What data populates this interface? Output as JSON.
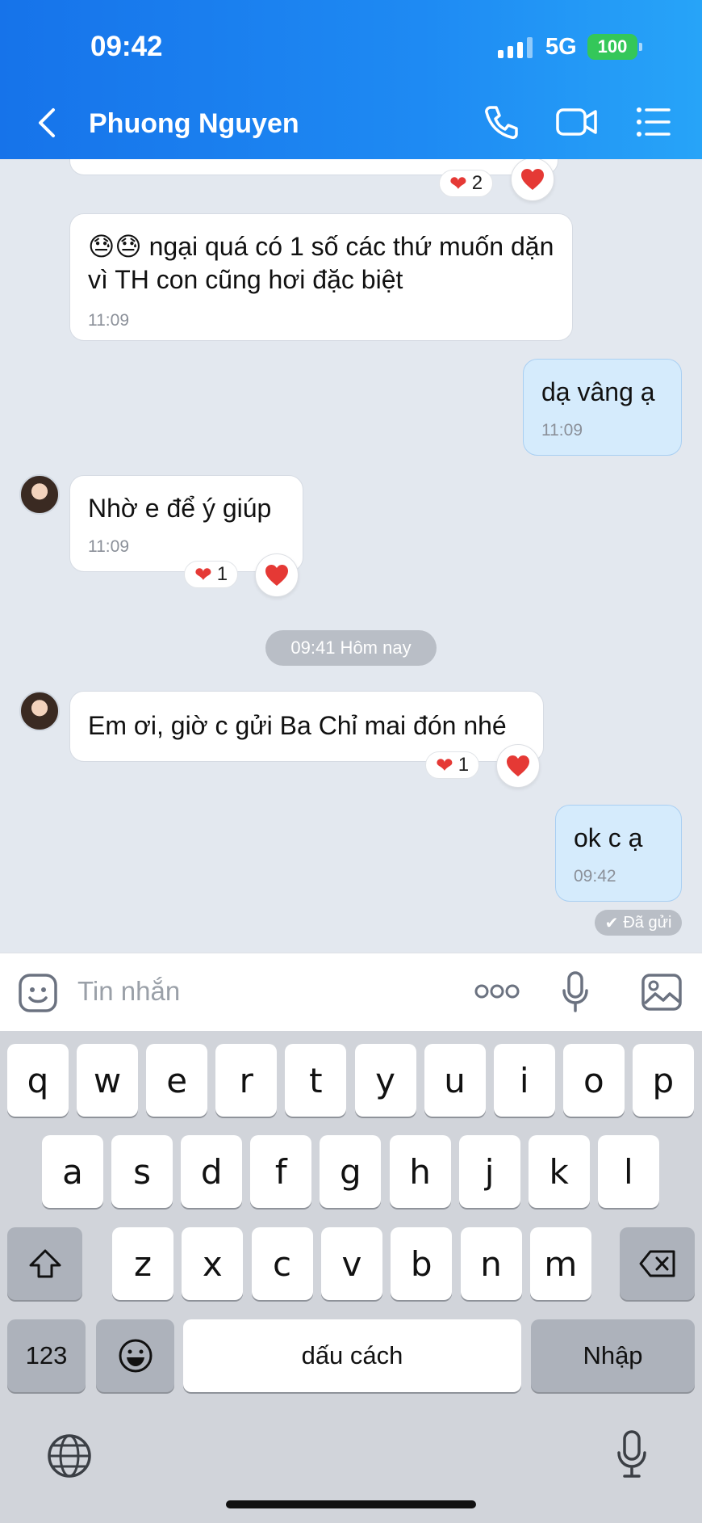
{
  "status": {
    "time": "09:42",
    "network": "5G",
    "battery": "100"
  },
  "header": {
    "contact_name": "Phuong Nguyen",
    "accent": "#1e8af3"
  },
  "messages": [
    {
      "sender": "other",
      "text": "ngại quá có 1 số các thứ muốn dặn vì TH con cũng hơi đặc biệt",
      "emojis": "😓😓",
      "time": "11:09"
    },
    {
      "sender": "me",
      "text": "dạ vâng ạ",
      "time": "11:09"
    },
    {
      "sender": "other",
      "text": "Nhờ e để ý giúp",
      "time": "11:09",
      "reaction_count": "1"
    },
    {
      "sender": "other",
      "text": "Em ơi, giờ c gửi Ba Chỉ mai đón nhé",
      "reaction_count": "1"
    },
    {
      "sender": "me",
      "text": "ok c ạ",
      "time": "09:42"
    }
  ],
  "top_reaction_count": "2",
  "date_divider": "09:41 Hôm nay",
  "sent_status": "Đã gửi",
  "input": {
    "placeholder": "Tin nhắn"
  },
  "keyboard": {
    "row1": [
      "q",
      "w",
      "e",
      "r",
      "t",
      "y",
      "u",
      "i",
      "o",
      "p"
    ],
    "row2": [
      "a",
      "s",
      "d",
      "f",
      "g",
      "h",
      "j",
      "k",
      "l"
    ],
    "row3": [
      "z",
      "x",
      "c",
      "v",
      "b",
      "n",
      "m"
    ],
    "numbers_key": "123",
    "space_key": "dấu cách",
    "return_key": "Nhập"
  },
  "icons": [
    "back-chevron-icon",
    "phone-icon",
    "video-icon",
    "list-icon",
    "sticker-icon",
    "more-icon",
    "mic-icon",
    "image-icon",
    "shift-icon",
    "backspace-icon",
    "emoji-icon",
    "globe-icon",
    "dictation-icon",
    "heart-icon"
  ]
}
